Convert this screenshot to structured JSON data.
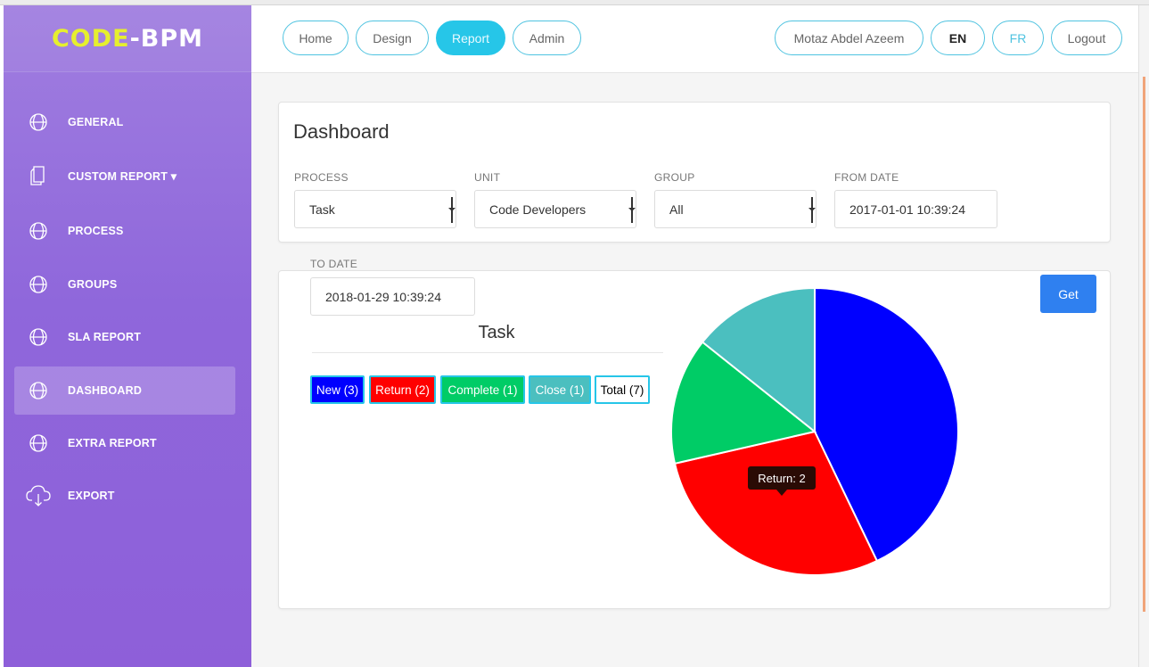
{
  "sidebar": {
    "logo_part1": "CODE",
    "logo_dash": "-",
    "logo_part2": "BPM",
    "items": [
      {
        "label": "GENERAL",
        "icon": "globe-icon"
      },
      {
        "label": "CUSTOM REPORT ▾",
        "icon": "document-icon"
      },
      {
        "label": "PROCESS",
        "icon": "globe-icon"
      },
      {
        "label": "GROUPS",
        "icon": "globe-icon"
      },
      {
        "label": "SLA REPORT",
        "icon": "globe-icon"
      },
      {
        "label": "DASHBOARD",
        "icon": "globe-icon",
        "active": true
      },
      {
        "label": "EXTRA REPORT",
        "icon": "globe-icon"
      },
      {
        "label": "EXPORT",
        "icon": "cloud-download-icon"
      }
    ]
  },
  "topnav": {
    "tabs": [
      {
        "label": "Home"
      },
      {
        "label": "Design"
      },
      {
        "label": "Report",
        "active": true
      },
      {
        "label": "Admin"
      }
    ],
    "user": "Motaz Abdel Azeem",
    "lang_en": "EN",
    "lang_fr": "FR",
    "logout": "Logout"
  },
  "dashboard": {
    "title": "Dashboard",
    "filters": {
      "process": {
        "label": "PROCESS",
        "value": "Task"
      },
      "unit": {
        "label": "UNIT",
        "value": "Code Developers"
      },
      "group": {
        "label": "GROUP",
        "value": "All"
      },
      "from_date": {
        "label": "FROM DATE",
        "value": "2017-01-01 10:39:24"
      },
      "to_date": {
        "label": "TO DATE",
        "value": "2018-01-29 10:39:24"
      }
    },
    "get_button": "Get",
    "chart_title": "Task",
    "legend": [
      {
        "label": "New (3)",
        "bg": "#0000ff",
        "color": "#ffffff"
      },
      {
        "label": "Return (2)",
        "bg": "#ff0000",
        "color": "#ffffff"
      },
      {
        "label": "Complete (1)",
        "bg": "#00cc66",
        "color": "#ffffff"
      },
      {
        "label": "Close (1)",
        "bg": "#4bbfbf",
        "color": "#ffffff"
      },
      {
        "label": "Total (7)",
        "bg": "#ffffff",
        "color": "#000000"
      }
    ],
    "tooltip": "Return: 2"
  },
  "chart_data": {
    "type": "pie",
    "title": "Task",
    "labels": [
      "New",
      "Return",
      "Complete",
      "Close"
    ],
    "values": [
      3,
      2,
      1,
      1
    ],
    "colors": [
      "#0000ff",
      "#ff0000",
      "#00cc66",
      "#4bbfbf"
    ],
    "total": 7
  }
}
